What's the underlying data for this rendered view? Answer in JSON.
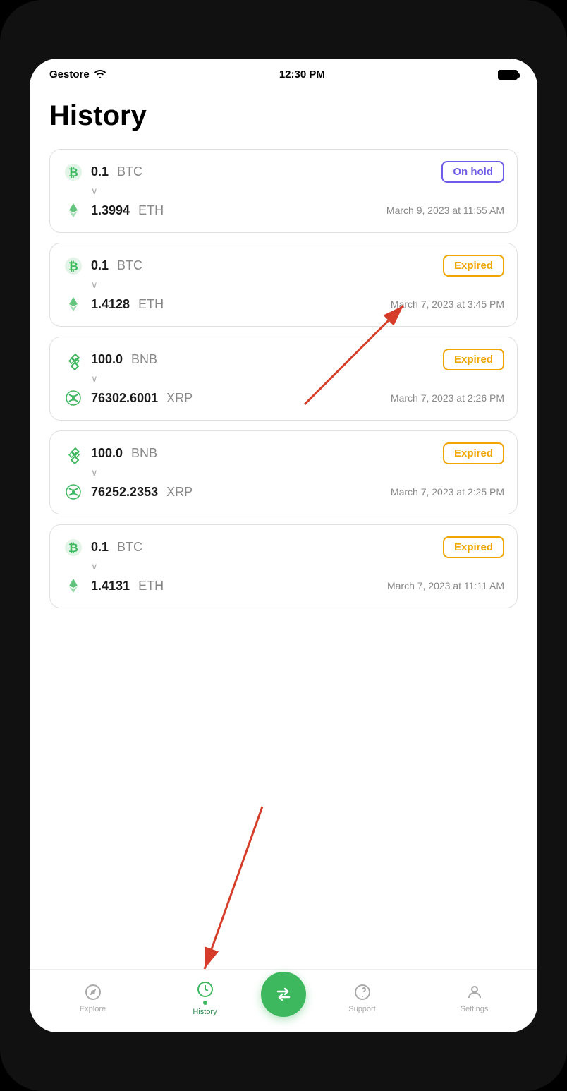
{
  "status_bar": {
    "carrier": "Gestore",
    "time": "12:30 PM"
  },
  "page": {
    "title": "History"
  },
  "transactions": [
    {
      "from_amount": "0.1",
      "from_symbol": "BTC",
      "from_icon": "btc",
      "to_amount": "1.3994",
      "to_symbol": "ETH",
      "to_icon": "eth",
      "status": "On hold",
      "status_type": "onhold",
      "date": "March 9, 2023 at 11:55 AM"
    },
    {
      "from_amount": "0.1",
      "from_symbol": "BTC",
      "from_icon": "btc",
      "to_amount": "1.4128",
      "to_symbol": "ETH",
      "to_icon": "eth",
      "status": "Expired",
      "status_type": "expired",
      "date": "March 7, 2023 at 3:45 PM"
    },
    {
      "from_amount": "100.0",
      "from_symbol": "BNB",
      "from_icon": "bnb",
      "to_amount": "76302.6001",
      "to_symbol": "XRP",
      "to_icon": "xrp",
      "status": "Expired",
      "status_type": "expired",
      "date": "March 7, 2023 at 2:26 PM"
    },
    {
      "from_amount": "100.0",
      "from_symbol": "BNB",
      "from_icon": "bnb",
      "to_amount": "76252.2353",
      "to_symbol": "XRP",
      "to_icon": "xrp",
      "status": "Expired",
      "status_type": "expired",
      "date": "March 7, 2023 at 2:25 PM"
    },
    {
      "from_amount": "0.1",
      "from_symbol": "BTC",
      "from_icon": "btc",
      "to_amount": "1.4131",
      "to_symbol": "ETH",
      "to_icon": "eth",
      "status": "Expired",
      "status_type": "expired",
      "date": "March 7, 2023 at 11:11 AM"
    }
  ],
  "nav": {
    "explore_label": "Explore",
    "history_label": "History",
    "support_label": "Support",
    "settings_label": "Settings"
  }
}
